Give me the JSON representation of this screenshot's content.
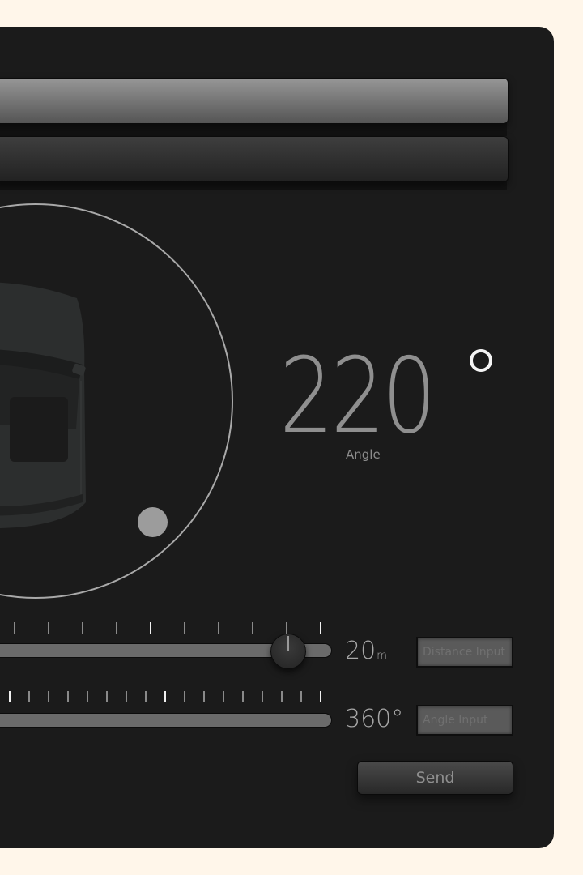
{
  "colors": {
    "background": "#fff6ea",
    "panel": "#1b1b1b",
    "accent_text": "#a8a8a8"
  },
  "mode_bars": [
    {
      "label": "",
      "active": true
    },
    {
      "label": "",
      "active": false
    }
  ],
  "radar": {
    "car_icon": "car-top-view",
    "target_marker": "target-dot"
  },
  "angle_display": {
    "value": "220",
    "degree_symbol": "°",
    "label": "Angle"
  },
  "distance_slider": {
    "value": "20",
    "unit": "m",
    "tick_count": 10,
    "major_ticks": [
      4,
      9
    ],
    "input_placeholder": "Distance Input"
  },
  "angle_slider": {
    "value": "360",
    "unit": "°",
    "tick_count": 17,
    "major_ticks": [
      0,
      8,
      16
    ],
    "input_placeholder": "Angle Input"
  },
  "send_button": {
    "label": "Send"
  }
}
